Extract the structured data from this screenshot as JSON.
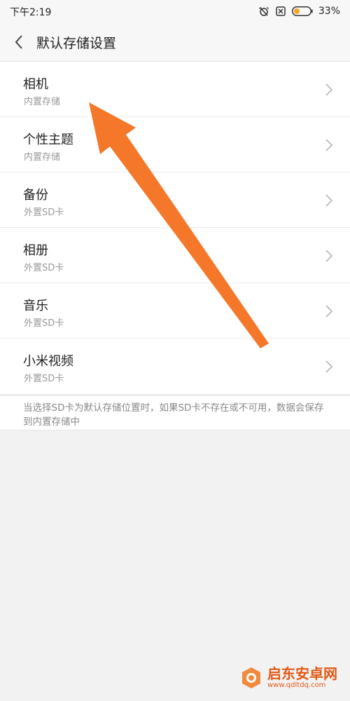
{
  "status_bar": {
    "time": "下午2:19",
    "battery": "33%",
    "icons": [
      "alarm-off-icon",
      "sim-x-icon",
      "battery-icon"
    ]
  },
  "header": {
    "title": "默认存储设置",
    "back_icon": "chevron-left-icon"
  },
  "storage_items": [
    {
      "title": "相机",
      "subtitle": "内置存储"
    },
    {
      "title": "个性主题",
      "subtitle": "内置存储"
    },
    {
      "title": "备份",
      "subtitle": "外置SD卡"
    },
    {
      "title": "相册",
      "subtitle": "外置SD卡"
    },
    {
      "title": "音乐",
      "subtitle": "外置SD卡"
    },
    {
      "title": "小米视频",
      "subtitle": "外置SD卡"
    }
  ],
  "footer_note": "当选择SD卡为默认存储位置时，如果SD卡不存在或不可用，数据会保存到内置存储中",
  "annotation": {
    "arrow_color": "#f5782a"
  },
  "watermark": {
    "name": "启东安卓网",
    "url": "www.qdltdq.com"
  }
}
